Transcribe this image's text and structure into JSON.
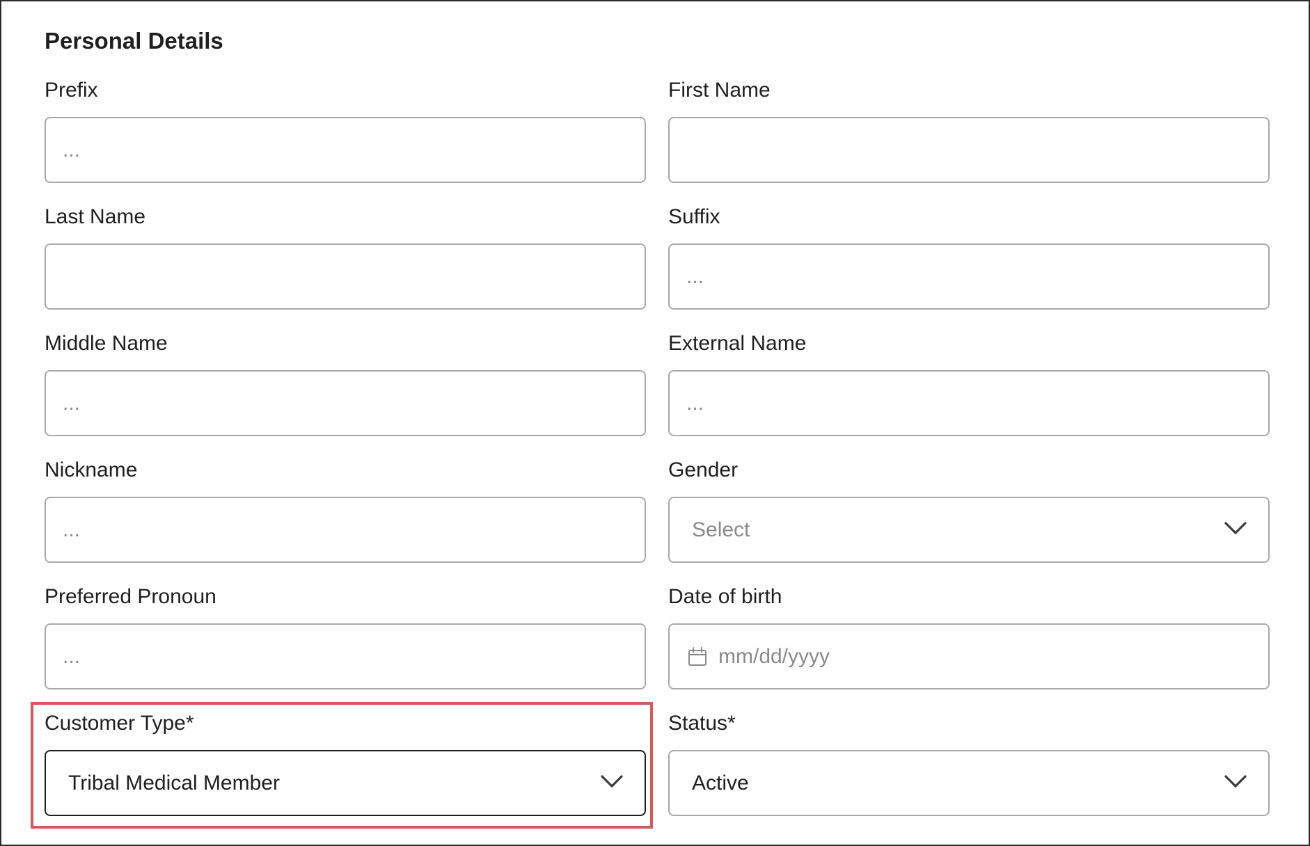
{
  "section": {
    "title": "Personal Details"
  },
  "fields": {
    "prefix": {
      "label": "Prefix",
      "placeholder": "...",
      "value": ""
    },
    "first_name": {
      "label": "First Name",
      "placeholder": "",
      "value": ""
    },
    "last_name": {
      "label": "Last Name",
      "placeholder": "",
      "value": ""
    },
    "suffix": {
      "label": "Suffix",
      "placeholder": "...",
      "value": ""
    },
    "middle_name": {
      "label": "Middle Name",
      "placeholder": "...",
      "value": ""
    },
    "external_name": {
      "label": "External Name",
      "placeholder": "...",
      "value": ""
    },
    "nickname": {
      "label": "Nickname",
      "placeholder": "...",
      "value": ""
    },
    "gender": {
      "label": "Gender",
      "selected": "Select"
    },
    "preferred_pronoun": {
      "label": "Preferred Pronoun",
      "placeholder": "...",
      "value": ""
    },
    "date_of_birth": {
      "label": "Date of birth",
      "placeholder": "mm/dd/yyyy"
    },
    "customer_type": {
      "label": "Customer Type*",
      "selected": "Tribal Medical Member"
    },
    "status": {
      "label": "Status*",
      "selected": "Active"
    }
  },
  "icons": {
    "dropdown": "chevron-down-icon",
    "date": "calendar-icon"
  },
  "colors": {
    "highlight": "#cf5b5b",
    "field_border": "#a9a9a9",
    "focused_border": "#1f1f1f",
    "placeholder": "#8a8a8a"
  }
}
